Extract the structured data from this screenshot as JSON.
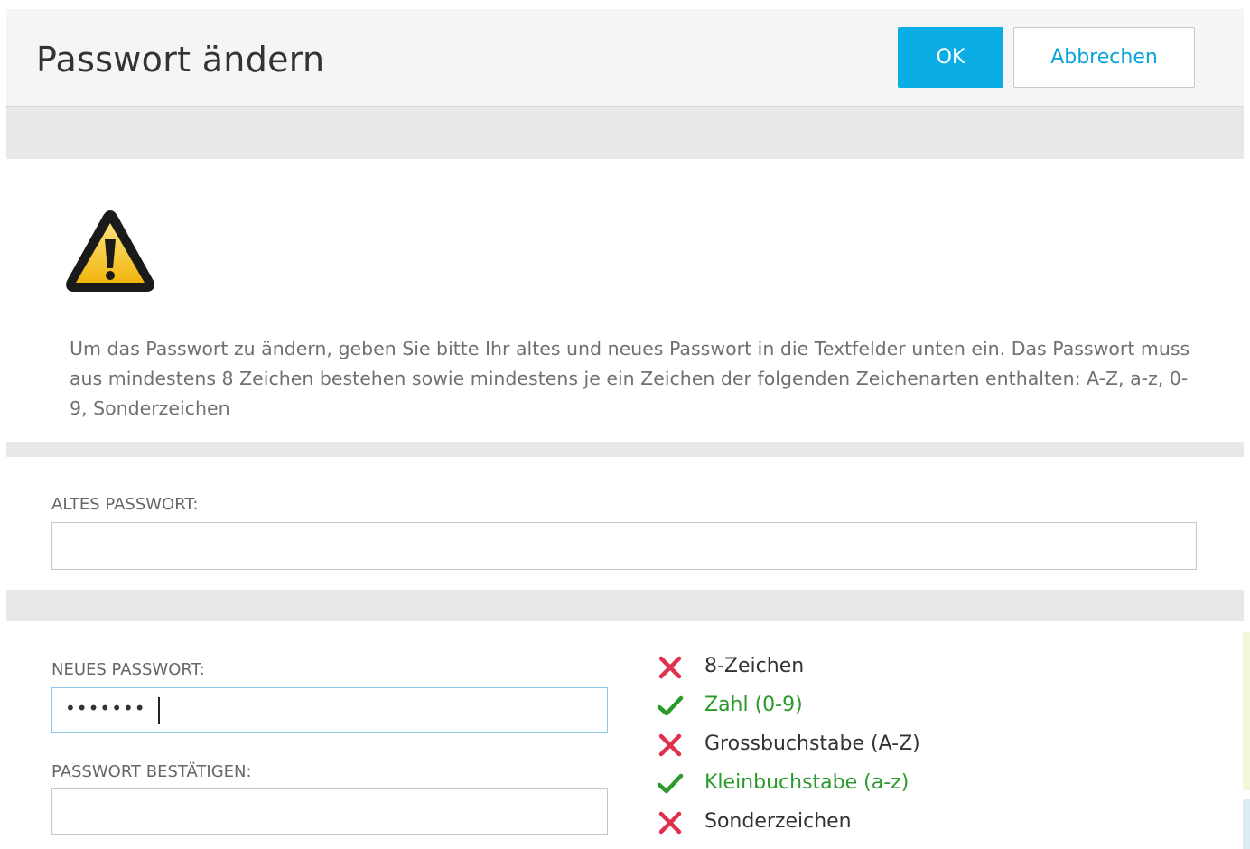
{
  "header": {
    "title": "Passwort ändern",
    "ok_label": "OK",
    "cancel_label": "Abbrechen"
  },
  "info": {
    "text": "Um das Passwort zu ändern, geben Sie bitte Ihr altes und neues Passwort in die Textfelder unten ein. Das Passwort muss aus mindestens 8 Zeichen bestehen sowie mindestens je ein Zeichen der folgenden Zeichenarten enthalten: A-Z, a-z, 0-9, Sonderzeichen"
  },
  "fields": {
    "old_password": {
      "label": "ALTES PASSWORT:",
      "value": ""
    },
    "new_password": {
      "label": "NEUES PASSWORT:",
      "value": "•••••••"
    },
    "confirm_password": {
      "label": "PASSWORT BESTÄTIGEN:",
      "value": ""
    }
  },
  "rules": [
    {
      "label": "8-Zeichen",
      "status": "fail"
    },
    {
      "label": "Zahl (0-9)",
      "status": "pass"
    },
    {
      "label": "Grossbuchstabe (A-Z)",
      "status": "fail"
    },
    {
      "label": "Kleinbuchstabe (a-z)",
      "status": "pass"
    },
    {
      "label": "Sonderzeichen",
      "status": "fail"
    }
  ],
  "colors": {
    "accent": "#0aade4",
    "pass": "#2a9a2a",
    "fail": "#e0304e",
    "warning_fill": "#f7c322"
  },
  "icons": {
    "warning": "warning-triangle-icon",
    "pass": "checkmark-icon",
    "fail": "cross-icon"
  }
}
